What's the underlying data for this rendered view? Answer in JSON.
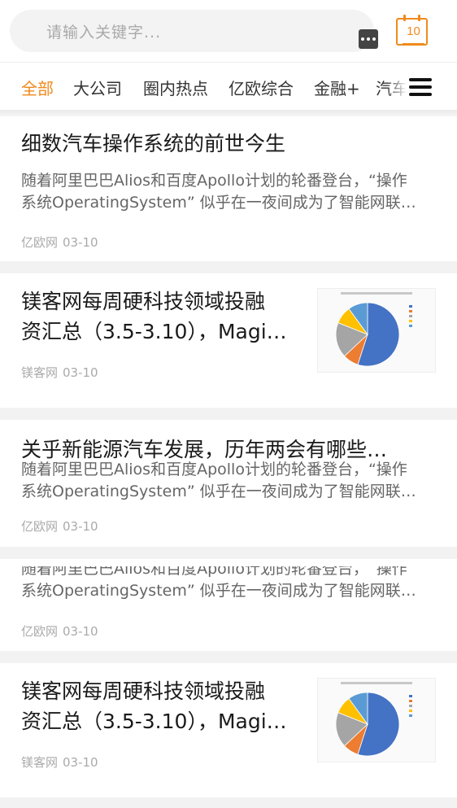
{
  "search": {
    "placeholder": "请输入关键字...",
    "more_icon": "more-dots-icon",
    "calendar_icon": "calendar-icon",
    "calendar_day": "10"
  },
  "colors": {
    "accent": "#f08a1c",
    "pie": [
      "#4472c4",
      "#ed7d31",
      "#a5a5a5",
      "#ffc000",
      "#5b9bd5"
    ]
  },
  "tabs": [
    {
      "label": "全部",
      "active": true
    },
    {
      "label": "大公司"
    },
    {
      "label": "圈内热点"
    },
    {
      "label": "亿欧综合"
    },
    {
      "label": "金融+"
    },
    {
      "label": "汽车"
    }
  ],
  "menu_icon": "hamburger-menu-icon",
  "articles": [
    {
      "title": "细数汽车操作系统的前世今生",
      "summary_line1": "随着阿里巴巴Alios和百度Apollo计划的轮番登台，“操作",
      "summary_line2": "系统OperatingSystem” 似乎在一夜间成为了智能网联…",
      "source": "亿欧网",
      "date": "03-10"
    },
    {
      "title_line1": "镁客网每周硬科技领域投融",
      "title_line2": "资汇总（3.5-3.10），Magi…",
      "source": "镁客网",
      "date": "03-10",
      "thumb_icon": "pie-chart-thumbnail",
      "pie_values": [
        55,
        8,
        18,
        9,
        10
      ]
    },
    {
      "title": "关乎新能源汽车发展，历年两会有哪些…",
      "summary_line1": "随着阿里巴巴Alios和百度Apollo计划的轮番登台，“操作",
      "summary_line2": "系统OperatingSystem” 似乎在一夜间成为了智能网联…",
      "source": "亿欧网",
      "date": "03-10"
    },
    {
      "summary_line1": "随着阿里巴巴Alios和百度Apollo计划的轮番登台，“操作",
      "summary_line2": "系统OperatingSystem” 似乎在一夜间成为了智能网联…",
      "source": "亿欧网",
      "date": "03-10"
    },
    {
      "title_line1": "镁客网每周硬科技领域投融",
      "title_line2": "资汇总（3.5-3.10），Magi…",
      "source": "镁客网",
      "date": "03-10",
      "thumb_icon": "pie-chart-thumbnail",
      "pie_values": [
        55,
        8,
        18,
        9,
        10
      ]
    }
  ]
}
